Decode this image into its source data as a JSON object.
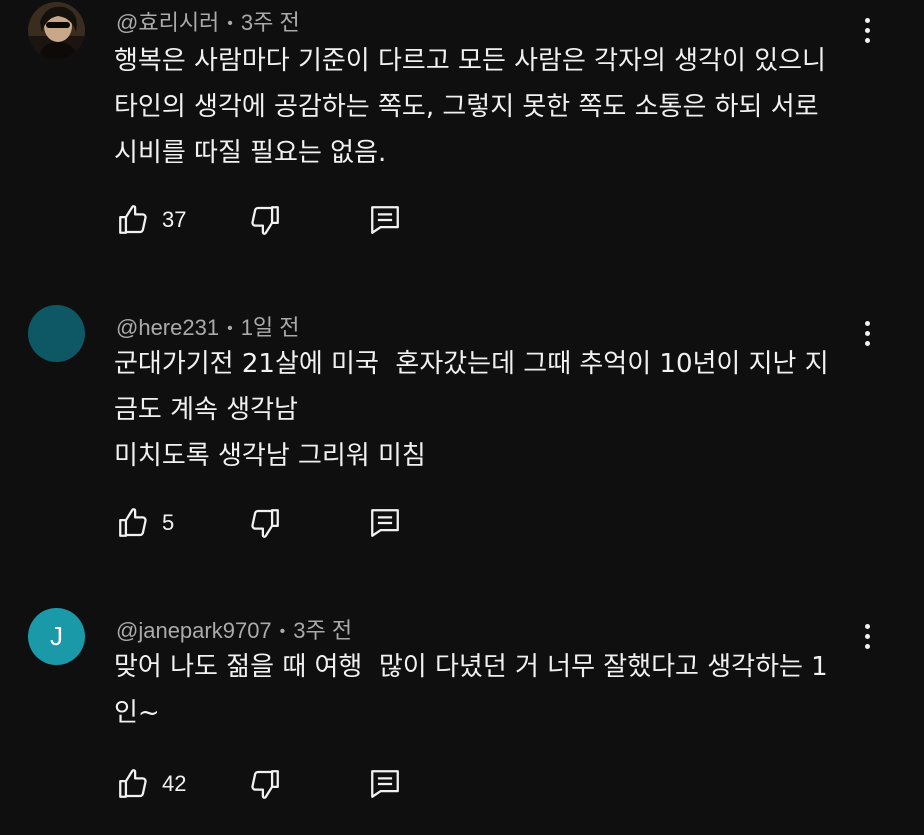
{
  "comments": [
    {
      "author": "@효리시러",
      "time": "3주 전",
      "text": "행복은 사람마다 기준이 다르고 모든 사람은 각자의 생각이 있으니\n타인의 생각에 공감하는 쪽도, 그렇지 못한 쪽도 소통은 하되 서로\n시비를 따질 필요는 없음.",
      "likes": "37",
      "avatar_type": "photo"
    },
    {
      "author": "@here231",
      "time": "1일 전",
      "text": "군대가기전 21살에 미국  혼자갔는데 그때 추억이 10년이 지난 지\n금도 계속 생각남\n미치도록 생각남 그리워 미침",
      "likes": "5",
      "avatar_color": "#0e5866"
    },
    {
      "author": "@janepark9707",
      "time": "3주 전",
      "text": "맞어 나도 젊을 때 여행  많이 다녔던 거 너무 잘했다고 생각하는 1\n인~",
      "likes": "42",
      "avatar_letter": "J",
      "avatar_color": "#1a9aa8"
    }
  ],
  "icons": {
    "like": "thumbs-up-icon",
    "dislike": "thumbs-down-icon",
    "reply": "reply-icon",
    "more": "more-vert-icon"
  },
  "colors": {
    "background": "#0f0f0f",
    "text": "#f1f1f1",
    "meta": "#aaaaaa"
  }
}
